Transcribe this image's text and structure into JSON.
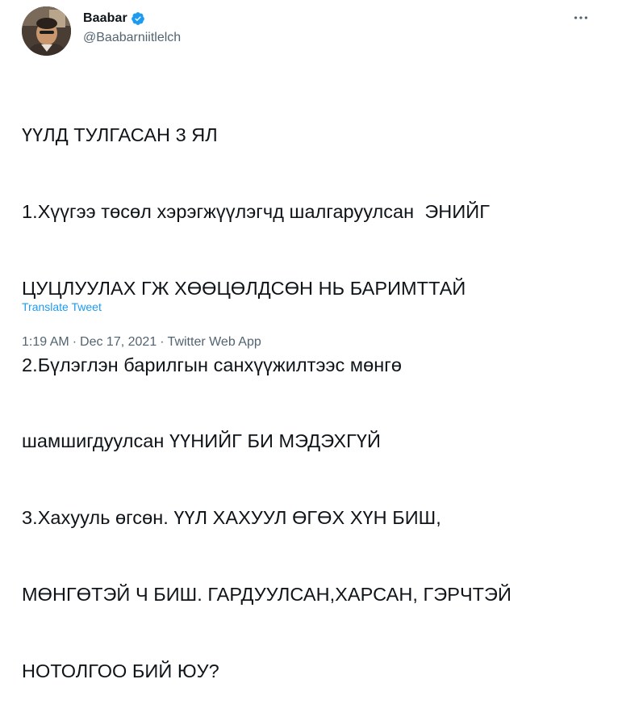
{
  "author": {
    "display_name": "Baabar",
    "handle": "@Baabarniitlelch",
    "verified": true
  },
  "more_icon": "more-horizontal-icon",
  "tweet": {
    "lines": [
      "ҮҮЛД ТУЛГАСАН 3 ЯЛ",
      "1.Хүүгээ төсөл хэрэгжүүлэгчд шалгаруулсан  ЭНИЙГ",
      "ЦУЦЛУУЛАХ ГЖ ХӨӨЦӨЛДСӨН НЬ БАРИМТТАЙ",
      "2.Бүлэглэн барилгын санхүүжилтээс мөнгө",
      "шамшигдуулсан ҮҮНИЙГ БИ МЭДЭХГҮЙ",
      "3.Хахууль өгсөн. ҮҮЛ ХАХУУЛ ӨГӨХ ХҮН БИШ,",
      "МӨНГӨТЭЙ Ч БИШ. ГАРДУУЛСАН,ХАРСАН, ГЭРЧТЭЙ",
      "НОТОЛГОО БИЙ ЮУ?"
    ],
    "translate_label": "Translate Tweet"
  },
  "meta": {
    "time": "1:19 AM",
    "date": "Dec 17, 2021",
    "source": "Twitter Web App",
    "separator": "·"
  },
  "colors": {
    "text": "#0f1419",
    "secondary": "#536471",
    "accent": "#1d9bf0"
  }
}
